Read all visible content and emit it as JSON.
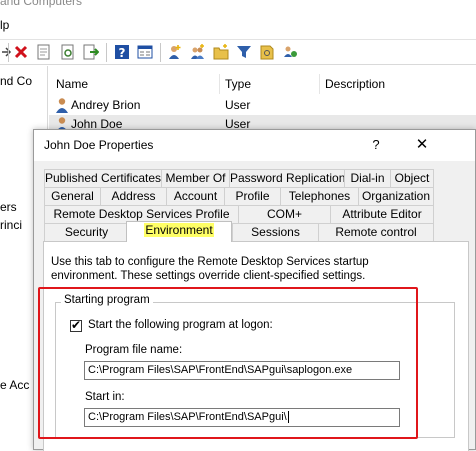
{
  "app": {
    "title_fragment": "and Computers",
    "menu_fragment": "lp"
  },
  "left_pane": {
    "items": [
      "nd Co",
      "ers",
      "rinci",
      "e Acc"
    ]
  },
  "list": {
    "columns": [
      "Name",
      "Type",
      "Description"
    ],
    "rows": [
      {
        "name": "Andrey Brion",
        "type": "User",
        "selected": false
      },
      {
        "name": "John Doe",
        "type": "User",
        "selected": true
      }
    ]
  },
  "dialog": {
    "title": "John Doe Properties",
    "help_label": "?",
    "close_label": "✕",
    "tabs_row1": [
      "Published Certificates",
      "Member Of",
      "Password Replication",
      "Dial-in",
      "Object"
    ],
    "tabs_row2": [
      "General",
      "Address",
      "Account",
      "Profile",
      "Telephones",
      "Organization"
    ],
    "tabs_row3": [
      "Remote Desktop Services Profile",
      "COM+",
      "Attribute Editor"
    ],
    "tabs_row4": [
      "Security",
      "Environment",
      "Sessions",
      "Remote control"
    ],
    "active_tab": "Environment",
    "highlight_color": "#ffff66",
    "description": "Use this tab to configure the Remote Desktop Services startup environment. These settings override client-specified settings.",
    "group_title": "Starting program",
    "checkbox_label": "Start the following program at logon:",
    "checkbox_checked": true,
    "program_label": "Program file name:",
    "program_value": "C:\\Program Files\\SAP\\FrontEnd\\SAPgui\\saplogon.exe",
    "startin_label": "Start in:",
    "startin_value": "C:\\Program Files\\SAP\\FrontEnd\\SAPgui\\",
    "annotation_color": "#e0161b"
  },
  "icons": {
    "toolbar": [
      "back-arrow-icon",
      "delete-icon",
      "properties-icon",
      "refresh-icon",
      "export-icon",
      "help-icon",
      "console-icon",
      "add-user-icon",
      "add-group-icon",
      "add-ou-icon",
      "filter-icon",
      "find-icon",
      "delegate-icon"
    ],
    "user": "user-icon"
  }
}
